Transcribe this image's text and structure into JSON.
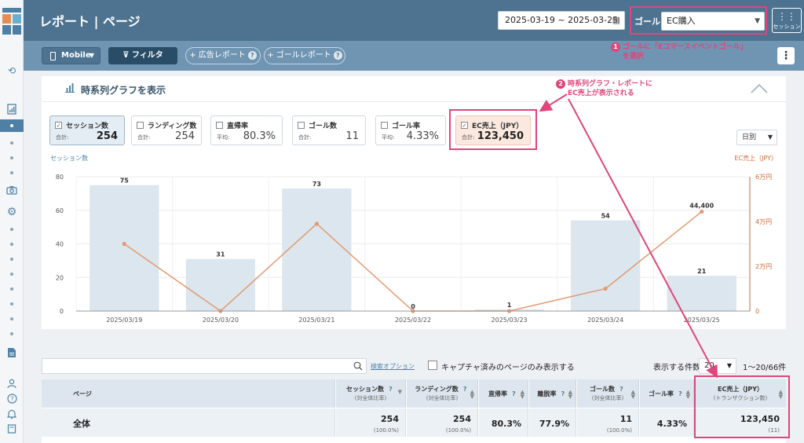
{
  "header": {
    "title": "レポート | ページ",
    "date_range": "2025-03-19 ~ 2025-03-25",
    "goal_label": "ゴール:",
    "goal_value": "EC購入",
    "session_label": "セッション"
  },
  "toolbar": {
    "device": "Mobile",
    "filter": "フィルタ",
    "ad_report": "+ 広告レポート",
    "goal_report": "+ ゴールレポート",
    "more": "⋮"
  },
  "annotations": {
    "a1_num": "1",
    "a1_line1": "ゴールに「Eコマースイベントゴール」",
    "a1_line2": "を選択",
    "a2_num": "2",
    "a2_line1": "時系列グラフ・レポートに",
    "a2_line2": "EC売上が表示される"
  },
  "panel": {
    "title": "時系列グラフを表示",
    "period": "日別"
  },
  "metrics": [
    {
      "name": "セッション数",
      "sub": "合計:",
      "value": "254",
      "checked": true
    },
    {
      "name": "ランディング数",
      "sub": "合計:",
      "value": "254",
      "checked": false
    },
    {
      "name": "直帰率",
      "sub": "平均:",
      "value": "80.3%",
      "checked": false
    },
    {
      "name": "ゴール数",
      "sub": "合計:",
      "value": "11",
      "checked": false
    },
    {
      "name": "ゴール率",
      "sub": "平均:",
      "value": "4.33%",
      "checked": false
    },
    {
      "name": "EC売上（JPY）",
      "sub": "合計:",
      "value": "123,450",
      "checked": true
    }
  ],
  "chart_data": {
    "type": "bar",
    "categories": [
      "2025/03/19",
      "2025/03/20",
      "2025/03/21",
      "2025/03/22",
      "2025/03/23",
      "2025/03/24",
      "2025/03/25"
    ],
    "ylabel": "セッション数",
    "ylabel_right": "EC売上（JPY）",
    "ylim": [
      0,
      80
    ],
    "yticks": [
      0,
      20,
      40,
      60,
      80
    ],
    "ylim_right": [
      0,
      60000
    ],
    "yticks_right": [
      "0",
      "2万円",
      "4万円",
      "6万円"
    ],
    "series": [
      {
        "name": "セッション数",
        "type": "bar",
        "axis": "left",
        "values": [
          75,
          31,
          73,
          0,
          1,
          54,
          21
        ],
        "color": "#dbe6ee"
      },
      {
        "name": "EC売上（JPY）",
        "type": "line",
        "axis": "right",
        "values": [
          30000,
          0,
          39000,
          0,
          0,
          10000,
          44400
        ],
        "labeled_point": "44,400",
        "color": "#e39a72"
      }
    ]
  },
  "search": {
    "placeholder": "",
    "options_link": "検索オプション",
    "capture_only": "キャプチャ済みのページのみ表示する"
  },
  "pagination": {
    "label": "表示する件数",
    "per_page": "20",
    "range": "1〜20/66件"
  },
  "table": {
    "headers": [
      {
        "label": "ページ",
        "sub": ""
      },
      {
        "label": "セッション数",
        "sub": "(対全体比率)"
      },
      {
        "label": "ランディング数",
        "sub": "(対全体比率)"
      },
      {
        "label": "直帰率",
        "sub": ""
      },
      {
        "label": "離脱率",
        "sub": ""
      },
      {
        "label": "ゴール数",
        "sub": "(対全体比率)"
      },
      {
        "label": "ゴール率",
        "sub": ""
      },
      {
        "label": "EC売上（JPY）",
        "sub": "(トランザクション数)"
      }
    ],
    "total_row": {
      "page": "全体",
      "sessions": "254",
      "sessions_pct": "(100.0%)",
      "landings": "254",
      "landings_pct": "(100.0%)",
      "bounce": "80.3%",
      "exit": "77.9%",
      "goals": "11",
      "goals_pct": "(100.0%)",
      "goal_rate": "4.33%",
      "ec": "123,450",
      "ec_tx": "(11)"
    }
  },
  "colors": {
    "header": "#4d7391",
    "toolbar": "#6f95b3",
    "accent_pink": "#e0457b",
    "revenue_axis": "#c8693a"
  }
}
